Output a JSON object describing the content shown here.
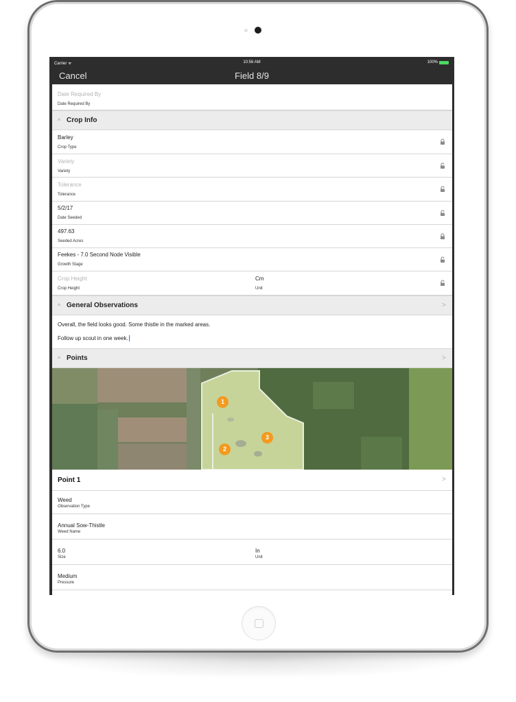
{
  "status_bar": {
    "carrier": "Carrier ᯤ",
    "time": "10:56 AM",
    "battery": "100%"
  },
  "nav": {
    "cancel": "Cancel",
    "title": "Field 8/9"
  },
  "date_required": {
    "value": "Date Required By",
    "label": "Date Required By"
  },
  "crop_info": {
    "title": "Crop Info",
    "crop_type": {
      "value": "Barley",
      "label": "Crop Type"
    },
    "variety": {
      "value": "Variety",
      "label": "Variety"
    },
    "tolerance": {
      "value": "Tolerance",
      "label": "Tolerance"
    },
    "date_seeded": {
      "value": "5/2/17",
      "label": "Date Seeded"
    },
    "seeded_acres": {
      "value": "497.63",
      "label": "Seeded Acres"
    },
    "growth_stage": {
      "value": "Feekes - 7.0 Second Node Visible",
      "label": "Growth Stage"
    },
    "crop_height": {
      "value": "Crop Height",
      "label": "Crop Height",
      "unit_value": "Cm",
      "unit_label": "Unit"
    }
  },
  "general_observations": {
    "title": "General Observations",
    "line1": "Overall, the field looks good. Some thistle in the marked areas.",
    "line2": "Follow up scout in one week."
  },
  "points": {
    "title": "Points",
    "markers": [
      "1",
      "2",
      "3"
    ],
    "marker_color": "#f39a1f"
  },
  "point1": {
    "title": "Point 1",
    "observation_type": {
      "value": "Weed",
      "label": "Observation Type"
    },
    "weed_name": {
      "value": "Annual Sow-Thistle",
      "label": "Weed Name"
    },
    "size": {
      "value": "6.0",
      "label": "Size",
      "unit_value": "In",
      "unit_label": "Unit"
    },
    "pressure": {
      "value": "Medium",
      "label": "Pressure"
    }
  },
  "colors": {
    "nav_bar": "#2d2d2d",
    "section_bg": "#ececec",
    "battery": "#4cd964"
  }
}
